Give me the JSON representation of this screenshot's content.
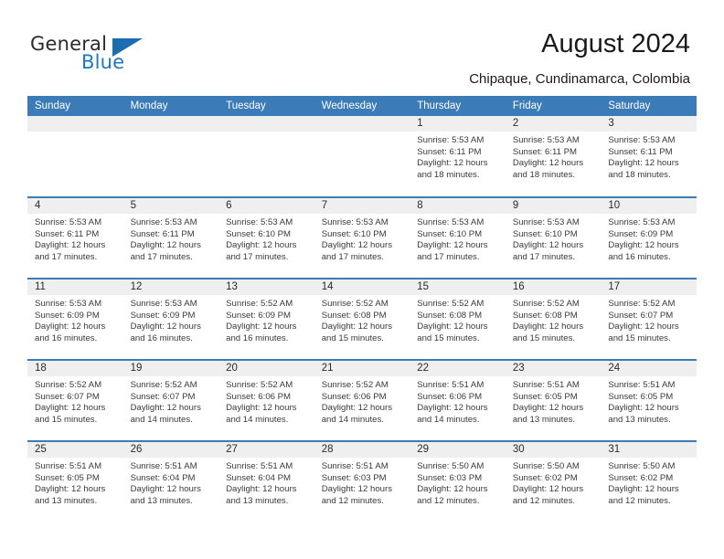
{
  "brand": {
    "name_part1": "General",
    "name_part2": "Blue",
    "accent_color": "#1b6cb0"
  },
  "header": {
    "title": "August 2024",
    "subtitle": "Chipaque, Cundinamarca, Colombia"
  },
  "calendar": {
    "header_bg": "#3b7cb8",
    "daynum_bg": "#efefef",
    "weekday_headers": [
      "Sunday",
      "Monday",
      "Tuesday",
      "Wednesday",
      "Thursday",
      "Friday",
      "Saturday"
    ],
    "weeks": [
      [
        {
          "day": "",
          "sunrise": "",
          "sunset": "",
          "daylight1": "",
          "daylight2": ""
        },
        {
          "day": "",
          "sunrise": "",
          "sunset": "",
          "daylight1": "",
          "daylight2": ""
        },
        {
          "day": "",
          "sunrise": "",
          "sunset": "",
          "daylight1": "",
          "daylight2": ""
        },
        {
          "day": "",
          "sunrise": "",
          "sunset": "",
          "daylight1": "",
          "daylight2": ""
        },
        {
          "day": "1",
          "sunrise": "Sunrise: 5:53 AM",
          "sunset": "Sunset: 6:11 PM",
          "daylight1": "Daylight: 12 hours",
          "daylight2": "and 18 minutes."
        },
        {
          "day": "2",
          "sunrise": "Sunrise: 5:53 AM",
          "sunset": "Sunset: 6:11 PM",
          "daylight1": "Daylight: 12 hours",
          "daylight2": "and 18 minutes."
        },
        {
          "day": "3",
          "sunrise": "Sunrise: 5:53 AM",
          "sunset": "Sunset: 6:11 PM",
          "daylight1": "Daylight: 12 hours",
          "daylight2": "and 18 minutes."
        }
      ],
      [
        {
          "day": "4",
          "sunrise": "Sunrise: 5:53 AM",
          "sunset": "Sunset: 6:11 PM",
          "daylight1": "Daylight: 12 hours",
          "daylight2": "and 17 minutes."
        },
        {
          "day": "5",
          "sunrise": "Sunrise: 5:53 AM",
          "sunset": "Sunset: 6:11 PM",
          "daylight1": "Daylight: 12 hours",
          "daylight2": "and 17 minutes."
        },
        {
          "day": "6",
          "sunrise": "Sunrise: 5:53 AM",
          "sunset": "Sunset: 6:10 PM",
          "daylight1": "Daylight: 12 hours",
          "daylight2": "and 17 minutes."
        },
        {
          "day": "7",
          "sunrise": "Sunrise: 5:53 AM",
          "sunset": "Sunset: 6:10 PM",
          "daylight1": "Daylight: 12 hours",
          "daylight2": "and 17 minutes."
        },
        {
          "day": "8",
          "sunrise": "Sunrise: 5:53 AM",
          "sunset": "Sunset: 6:10 PM",
          "daylight1": "Daylight: 12 hours",
          "daylight2": "and 17 minutes."
        },
        {
          "day": "9",
          "sunrise": "Sunrise: 5:53 AM",
          "sunset": "Sunset: 6:10 PM",
          "daylight1": "Daylight: 12 hours",
          "daylight2": "and 17 minutes."
        },
        {
          "day": "10",
          "sunrise": "Sunrise: 5:53 AM",
          "sunset": "Sunset: 6:09 PM",
          "daylight1": "Daylight: 12 hours",
          "daylight2": "and 16 minutes."
        }
      ],
      [
        {
          "day": "11",
          "sunrise": "Sunrise: 5:53 AM",
          "sunset": "Sunset: 6:09 PM",
          "daylight1": "Daylight: 12 hours",
          "daylight2": "and 16 minutes."
        },
        {
          "day": "12",
          "sunrise": "Sunrise: 5:53 AM",
          "sunset": "Sunset: 6:09 PM",
          "daylight1": "Daylight: 12 hours",
          "daylight2": "and 16 minutes."
        },
        {
          "day": "13",
          "sunrise": "Sunrise: 5:52 AM",
          "sunset": "Sunset: 6:09 PM",
          "daylight1": "Daylight: 12 hours",
          "daylight2": "and 16 minutes."
        },
        {
          "day": "14",
          "sunrise": "Sunrise: 5:52 AM",
          "sunset": "Sunset: 6:08 PM",
          "daylight1": "Daylight: 12 hours",
          "daylight2": "and 15 minutes."
        },
        {
          "day": "15",
          "sunrise": "Sunrise: 5:52 AM",
          "sunset": "Sunset: 6:08 PM",
          "daylight1": "Daylight: 12 hours",
          "daylight2": "and 15 minutes."
        },
        {
          "day": "16",
          "sunrise": "Sunrise: 5:52 AM",
          "sunset": "Sunset: 6:08 PM",
          "daylight1": "Daylight: 12 hours",
          "daylight2": "and 15 minutes."
        },
        {
          "day": "17",
          "sunrise": "Sunrise: 5:52 AM",
          "sunset": "Sunset: 6:07 PM",
          "daylight1": "Daylight: 12 hours",
          "daylight2": "and 15 minutes."
        }
      ],
      [
        {
          "day": "18",
          "sunrise": "Sunrise: 5:52 AM",
          "sunset": "Sunset: 6:07 PM",
          "daylight1": "Daylight: 12 hours",
          "daylight2": "and 15 minutes."
        },
        {
          "day": "19",
          "sunrise": "Sunrise: 5:52 AM",
          "sunset": "Sunset: 6:07 PM",
          "daylight1": "Daylight: 12 hours",
          "daylight2": "and 14 minutes."
        },
        {
          "day": "20",
          "sunrise": "Sunrise: 5:52 AM",
          "sunset": "Sunset: 6:06 PM",
          "daylight1": "Daylight: 12 hours",
          "daylight2": "and 14 minutes."
        },
        {
          "day": "21",
          "sunrise": "Sunrise: 5:52 AM",
          "sunset": "Sunset: 6:06 PM",
          "daylight1": "Daylight: 12 hours",
          "daylight2": "and 14 minutes."
        },
        {
          "day": "22",
          "sunrise": "Sunrise: 5:51 AM",
          "sunset": "Sunset: 6:06 PM",
          "daylight1": "Daylight: 12 hours",
          "daylight2": "and 14 minutes."
        },
        {
          "day": "23",
          "sunrise": "Sunrise: 5:51 AM",
          "sunset": "Sunset: 6:05 PM",
          "daylight1": "Daylight: 12 hours",
          "daylight2": "and 13 minutes."
        },
        {
          "day": "24",
          "sunrise": "Sunrise: 5:51 AM",
          "sunset": "Sunset: 6:05 PM",
          "daylight1": "Daylight: 12 hours",
          "daylight2": "and 13 minutes."
        }
      ],
      [
        {
          "day": "25",
          "sunrise": "Sunrise: 5:51 AM",
          "sunset": "Sunset: 6:05 PM",
          "daylight1": "Daylight: 12 hours",
          "daylight2": "and 13 minutes."
        },
        {
          "day": "26",
          "sunrise": "Sunrise: 5:51 AM",
          "sunset": "Sunset: 6:04 PM",
          "daylight1": "Daylight: 12 hours",
          "daylight2": "and 13 minutes."
        },
        {
          "day": "27",
          "sunrise": "Sunrise: 5:51 AM",
          "sunset": "Sunset: 6:04 PM",
          "daylight1": "Daylight: 12 hours",
          "daylight2": "and 13 minutes."
        },
        {
          "day": "28",
          "sunrise": "Sunrise: 5:51 AM",
          "sunset": "Sunset: 6:03 PM",
          "daylight1": "Daylight: 12 hours",
          "daylight2": "and 12 minutes."
        },
        {
          "day": "29",
          "sunrise": "Sunrise: 5:50 AM",
          "sunset": "Sunset: 6:03 PM",
          "daylight1": "Daylight: 12 hours",
          "daylight2": "and 12 minutes."
        },
        {
          "day": "30",
          "sunrise": "Sunrise: 5:50 AM",
          "sunset": "Sunset: 6:02 PM",
          "daylight1": "Daylight: 12 hours",
          "daylight2": "and 12 minutes."
        },
        {
          "day": "31",
          "sunrise": "Sunrise: 5:50 AM",
          "sunset": "Sunset: 6:02 PM",
          "daylight1": "Daylight: 12 hours",
          "daylight2": "and 12 minutes."
        }
      ]
    ]
  }
}
